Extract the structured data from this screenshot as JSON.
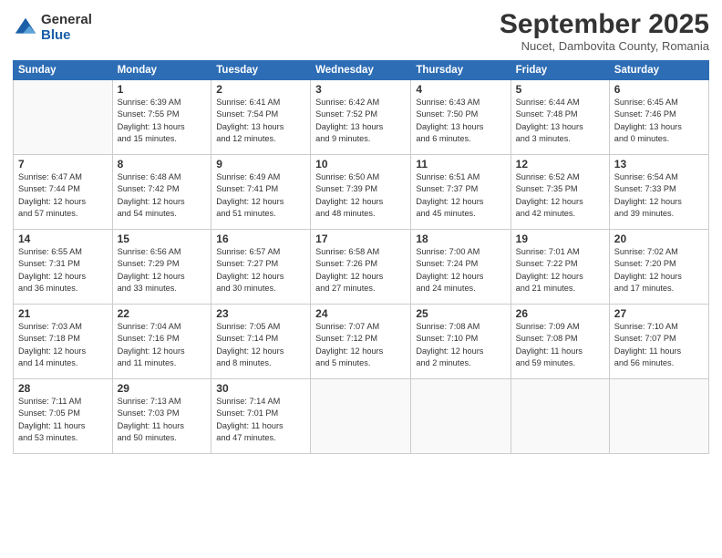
{
  "logo": {
    "general": "General",
    "blue": "Blue"
  },
  "title": "September 2025",
  "subtitle": "Nucet, Dambovita County, Romania",
  "headers": [
    "Sunday",
    "Monday",
    "Tuesday",
    "Wednesday",
    "Thursday",
    "Friday",
    "Saturday"
  ],
  "weeks": [
    [
      {
        "num": "",
        "info": ""
      },
      {
        "num": "1",
        "info": "Sunrise: 6:39 AM\nSunset: 7:55 PM\nDaylight: 13 hours\nand 15 minutes."
      },
      {
        "num": "2",
        "info": "Sunrise: 6:41 AM\nSunset: 7:54 PM\nDaylight: 13 hours\nand 12 minutes."
      },
      {
        "num": "3",
        "info": "Sunrise: 6:42 AM\nSunset: 7:52 PM\nDaylight: 13 hours\nand 9 minutes."
      },
      {
        "num": "4",
        "info": "Sunrise: 6:43 AM\nSunset: 7:50 PM\nDaylight: 13 hours\nand 6 minutes."
      },
      {
        "num": "5",
        "info": "Sunrise: 6:44 AM\nSunset: 7:48 PM\nDaylight: 13 hours\nand 3 minutes."
      },
      {
        "num": "6",
        "info": "Sunrise: 6:45 AM\nSunset: 7:46 PM\nDaylight: 13 hours\nand 0 minutes."
      }
    ],
    [
      {
        "num": "7",
        "info": "Sunrise: 6:47 AM\nSunset: 7:44 PM\nDaylight: 12 hours\nand 57 minutes."
      },
      {
        "num": "8",
        "info": "Sunrise: 6:48 AM\nSunset: 7:42 PM\nDaylight: 12 hours\nand 54 minutes."
      },
      {
        "num": "9",
        "info": "Sunrise: 6:49 AM\nSunset: 7:41 PM\nDaylight: 12 hours\nand 51 minutes."
      },
      {
        "num": "10",
        "info": "Sunrise: 6:50 AM\nSunset: 7:39 PM\nDaylight: 12 hours\nand 48 minutes."
      },
      {
        "num": "11",
        "info": "Sunrise: 6:51 AM\nSunset: 7:37 PM\nDaylight: 12 hours\nand 45 minutes."
      },
      {
        "num": "12",
        "info": "Sunrise: 6:52 AM\nSunset: 7:35 PM\nDaylight: 12 hours\nand 42 minutes."
      },
      {
        "num": "13",
        "info": "Sunrise: 6:54 AM\nSunset: 7:33 PM\nDaylight: 12 hours\nand 39 minutes."
      }
    ],
    [
      {
        "num": "14",
        "info": "Sunrise: 6:55 AM\nSunset: 7:31 PM\nDaylight: 12 hours\nand 36 minutes."
      },
      {
        "num": "15",
        "info": "Sunrise: 6:56 AM\nSunset: 7:29 PM\nDaylight: 12 hours\nand 33 minutes."
      },
      {
        "num": "16",
        "info": "Sunrise: 6:57 AM\nSunset: 7:27 PM\nDaylight: 12 hours\nand 30 minutes."
      },
      {
        "num": "17",
        "info": "Sunrise: 6:58 AM\nSunset: 7:26 PM\nDaylight: 12 hours\nand 27 minutes."
      },
      {
        "num": "18",
        "info": "Sunrise: 7:00 AM\nSunset: 7:24 PM\nDaylight: 12 hours\nand 24 minutes."
      },
      {
        "num": "19",
        "info": "Sunrise: 7:01 AM\nSunset: 7:22 PM\nDaylight: 12 hours\nand 21 minutes."
      },
      {
        "num": "20",
        "info": "Sunrise: 7:02 AM\nSunset: 7:20 PM\nDaylight: 12 hours\nand 17 minutes."
      }
    ],
    [
      {
        "num": "21",
        "info": "Sunrise: 7:03 AM\nSunset: 7:18 PM\nDaylight: 12 hours\nand 14 minutes."
      },
      {
        "num": "22",
        "info": "Sunrise: 7:04 AM\nSunset: 7:16 PM\nDaylight: 12 hours\nand 11 minutes."
      },
      {
        "num": "23",
        "info": "Sunrise: 7:05 AM\nSunset: 7:14 PM\nDaylight: 12 hours\nand 8 minutes."
      },
      {
        "num": "24",
        "info": "Sunrise: 7:07 AM\nSunset: 7:12 PM\nDaylight: 12 hours\nand 5 minutes."
      },
      {
        "num": "25",
        "info": "Sunrise: 7:08 AM\nSunset: 7:10 PM\nDaylight: 12 hours\nand 2 minutes."
      },
      {
        "num": "26",
        "info": "Sunrise: 7:09 AM\nSunset: 7:08 PM\nDaylight: 11 hours\nand 59 minutes."
      },
      {
        "num": "27",
        "info": "Sunrise: 7:10 AM\nSunset: 7:07 PM\nDaylight: 11 hours\nand 56 minutes."
      }
    ],
    [
      {
        "num": "28",
        "info": "Sunrise: 7:11 AM\nSunset: 7:05 PM\nDaylight: 11 hours\nand 53 minutes."
      },
      {
        "num": "29",
        "info": "Sunrise: 7:13 AM\nSunset: 7:03 PM\nDaylight: 11 hours\nand 50 minutes."
      },
      {
        "num": "30",
        "info": "Sunrise: 7:14 AM\nSunset: 7:01 PM\nDaylight: 11 hours\nand 47 minutes."
      },
      {
        "num": "",
        "info": ""
      },
      {
        "num": "",
        "info": ""
      },
      {
        "num": "",
        "info": ""
      },
      {
        "num": "",
        "info": ""
      }
    ]
  ]
}
